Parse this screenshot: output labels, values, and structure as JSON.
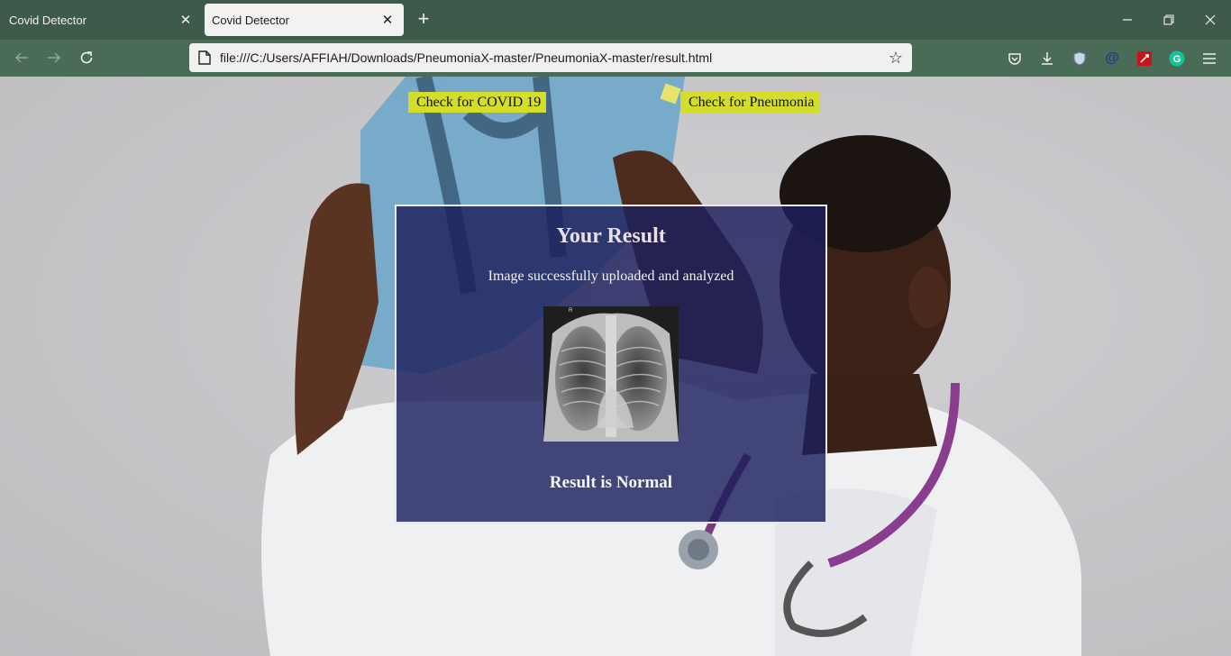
{
  "browser": {
    "tabs": [
      {
        "title": "Covid Detector",
        "active": false
      },
      {
        "title": "Covid Detector",
        "active": true
      }
    ],
    "url": "file:///C:/Users/AFFIAH/Downloads/PneumoniaX-master/PneumoniaX-master/result.html",
    "icons": {
      "back": "back-arrow-icon",
      "forward": "forward-arrow-icon",
      "reload": "reload-icon",
      "bookmark": "star-icon",
      "pocket": "pocket-icon",
      "downloads": "download-icon",
      "extensions": [
        "shield-extension-icon",
        "at-extension-icon",
        "red-extension-icon",
        "grammarly-icon"
      ],
      "menu": "hamburger-menu-icon"
    },
    "colors": {
      "tabbar": "#3d5a4a",
      "toolbar": "#4a6b56"
    }
  },
  "page": {
    "nav": {
      "covid_label": "Check for COVID 19",
      "pneumonia_label": "Check for Pneumonia"
    },
    "result": {
      "title": "Your Result",
      "subtitle": "Image successfully uploaded and analyzed",
      "xray_marker": "R",
      "verdict": "Result is Normal"
    },
    "colors": {
      "nav_button": "#d4de2a",
      "result_panel": "#1c1e5c"
    }
  }
}
